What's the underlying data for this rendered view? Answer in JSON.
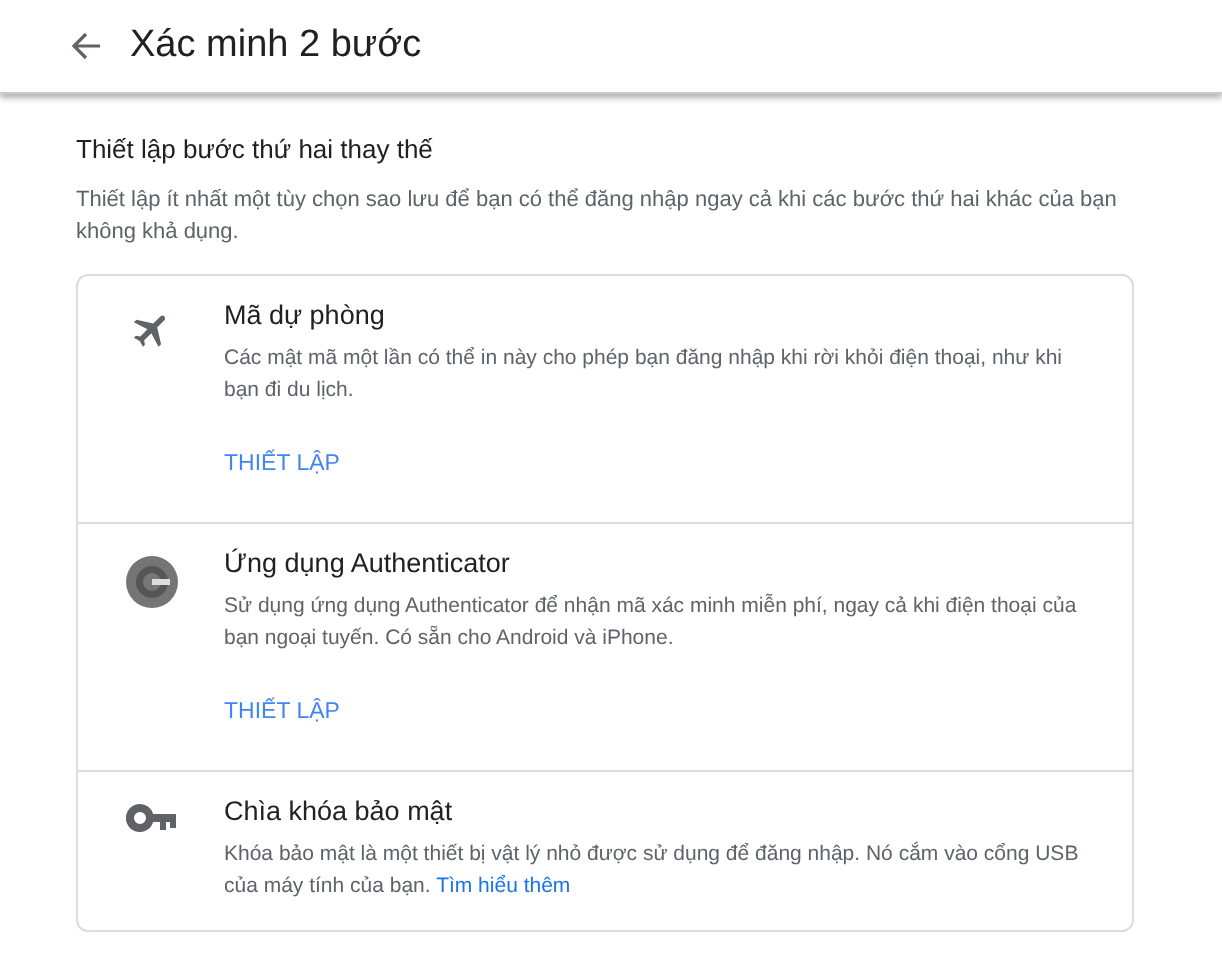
{
  "header": {
    "title": "Xác minh 2 bước"
  },
  "section": {
    "heading": "Thiết lập bước thứ hai thay thế",
    "description": "Thiết lập ít nhất một tùy chọn sao lưu để bạn có thể đăng nhập ngay cả khi các bước thứ hai khác của bạn không khả dụng."
  },
  "options": [
    {
      "kind": "backup-codes",
      "title": "Mã dự phòng",
      "description": "Các mật mã một lần có thể in này cho phép bạn đăng nhập khi rời khỏi điện thoại, như khi bạn đi du lịch.",
      "action": "THIẾT LẬP"
    },
    {
      "kind": "authenticator",
      "title": "Ứng dụng Authenticator",
      "description": "Sử dụng ứng dụng Authenticator để nhận mã xác minh miễn phí, ngay cả khi điện thoại của bạn ngoại tuyến. Có sẵn cho Android và iPhone.",
      "action": "THIẾT LẬP"
    },
    {
      "kind": "security-key",
      "title": "Chìa khóa bảo mật",
      "description": "Khóa bảo mật là một thiết bị vật lý nhỏ được sử dụng để đăng nhập. Nó cắm vào cổng USB của máy tính của bạn.",
      "link": "Tìm hiểu thêm"
    }
  ]
}
